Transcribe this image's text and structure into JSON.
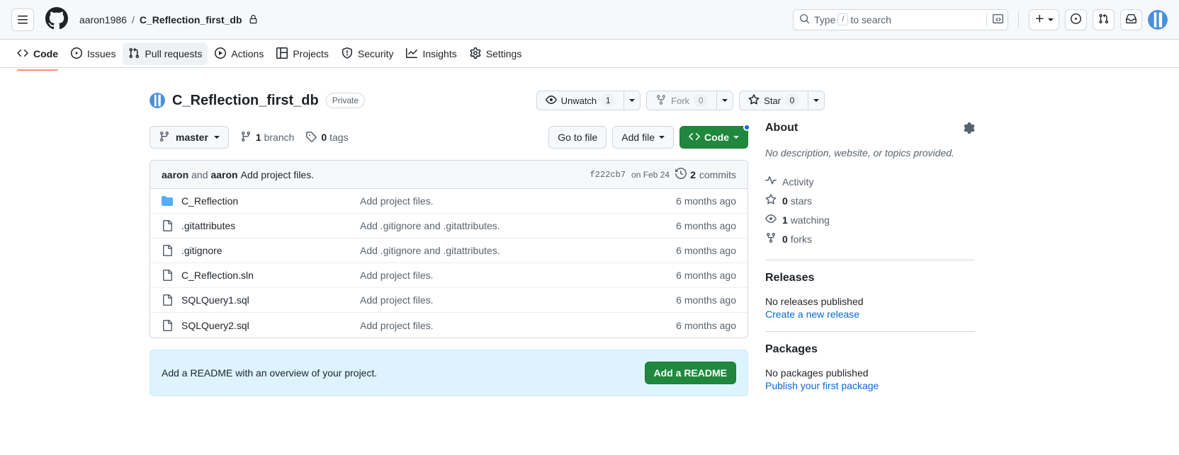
{
  "header": {
    "menu_icon": "hamburger-icon",
    "logo_icon": "github-logo-icon",
    "owner": "aaron1986",
    "separator": "/",
    "repo": "C_Reflection_first_db",
    "lock_icon": "lock-icon",
    "search_placeholder_prefix": "Type",
    "search_key": "/",
    "search_placeholder_suffix": "to search",
    "terminal_icon": "terminal-icon",
    "plus_label": "+",
    "issues_icon": "issue-opened-icon",
    "pull_requests_icon": "git-pull-request-icon",
    "inbox_icon": "inbox-icon",
    "avatar_icon": "user-avatar"
  },
  "nav": {
    "items": [
      {
        "label": "Code",
        "icon": "code-icon",
        "state": "active"
      },
      {
        "label": "Issues",
        "icon": "issue-opened-icon",
        "state": "normal"
      },
      {
        "label": "Pull requests",
        "icon": "git-pull-request-icon",
        "state": "hovered"
      },
      {
        "label": "Actions",
        "icon": "play-icon",
        "state": "normal"
      },
      {
        "label": "Projects",
        "icon": "table-icon",
        "state": "normal"
      },
      {
        "label": "Security",
        "icon": "shield-icon",
        "state": "normal"
      },
      {
        "label": "Insights",
        "icon": "graph-icon",
        "state": "normal"
      },
      {
        "label": "Settings",
        "icon": "gear-icon",
        "state": "normal"
      }
    ]
  },
  "repo": {
    "avatar_icon": "repo-owner-avatar",
    "name": "C_Reflection_first_db",
    "visibility": "Private",
    "watch": {
      "label": "Unwatch",
      "count": "1",
      "icon": "eye-icon"
    },
    "fork": {
      "label": "Fork",
      "count": "0",
      "icon": "repo-forked-icon"
    },
    "star": {
      "label": "Star",
      "count": "0",
      "icon": "star-icon"
    }
  },
  "toolbar": {
    "branch": "master",
    "branch_icon": "git-branch-icon",
    "branches_count": "1",
    "branches_label": "branch",
    "tags_count": "0",
    "tags_label": "tags",
    "tag_icon": "tag-icon",
    "go_to_file": "Go to file",
    "add_file": "Add file",
    "code_label": "Code",
    "code_icon": "code-icon"
  },
  "commit_bar": {
    "author_1": "aaron",
    "and": "and",
    "author_2": "aaron",
    "message": "Add project files.",
    "sha": "f222cb7",
    "date": "on Feb 24",
    "history_icon": "history-icon",
    "commits_count": "2",
    "commits_label": "commits"
  },
  "files": [
    {
      "name": "C_Reflection",
      "type": "folder",
      "icon": "folder-icon",
      "message": "Add project files.",
      "age": "6 months ago"
    },
    {
      "name": ".gitattributes",
      "type": "file",
      "icon": "file-icon",
      "message": "Add .gitignore and .gitattributes.",
      "age": "6 months ago"
    },
    {
      "name": ".gitignore",
      "type": "file",
      "icon": "file-icon",
      "message": "Add .gitignore and .gitattributes.",
      "age": "6 months ago"
    },
    {
      "name": "C_Reflection.sln",
      "type": "file",
      "icon": "file-icon",
      "message": "Add project files.",
      "age": "6 months ago"
    },
    {
      "name": "SQLQuery1.sql",
      "type": "file",
      "icon": "file-icon",
      "message": "Add project files.",
      "age": "6 months ago"
    },
    {
      "name": "SQLQuery2.sql",
      "type": "file",
      "icon": "file-icon",
      "message": "Add project files.",
      "age": "6 months ago"
    }
  ],
  "readme_cta": {
    "text": "Add a README with an overview of your project.",
    "button": "Add a README"
  },
  "sidebar": {
    "about_title": "About",
    "gear_icon": "gear-icon",
    "description": "No description, website, or topics provided.",
    "links": [
      {
        "label": "Activity",
        "icon": "pulse-icon",
        "count": ""
      },
      {
        "label": "stars",
        "icon": "star-icon",
        "count": "0"
      },
      {
        "label": "watching",
        "icon": "eye-icon",
        "count": "1"
      },
      {
        "label": "forks",
        "icon": "repo-forked-icon",
        "count": "0"
      }
    ],
    "releases_title": "Releases",
    "releases_note": "No releases published",
    "releases_link": "Create a new release",
    "packages_title": "Packages",
    "packages_note": "No packages published",
    "packages_link": "Publish your first package"
  },
  "colors": {
    "accent": "#0969da",
    "green": "#1f883d",
    "active_underline": "#fd8c73",
    "folder_blue": "#54aeff",
    "info_bg": "#ddf4ff",
    "border": "#d1d9e0",
    "muted_text": "#59636e"
  }
}
